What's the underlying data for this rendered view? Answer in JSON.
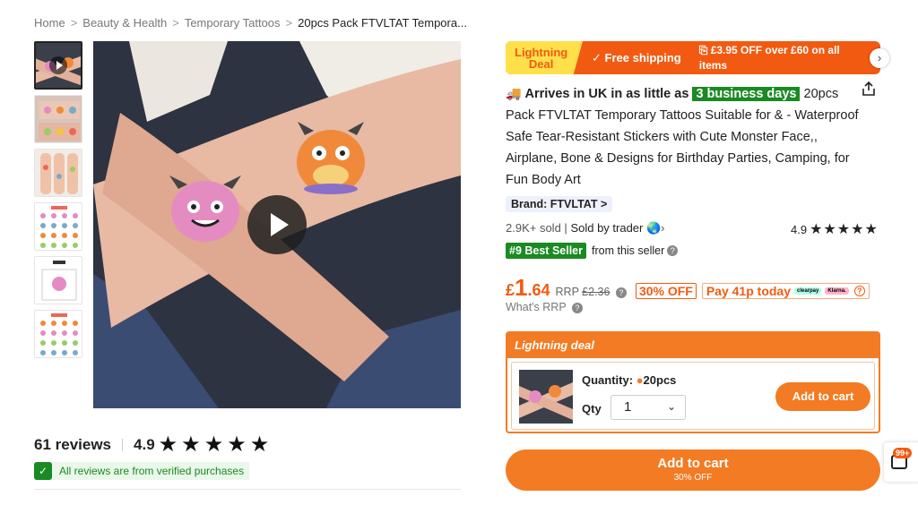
{
  "breadcrumb": {
    "items": [
      "Home",
      "Beauty & Health",
      "Temporary Tattoos",
      "20pcs Pack FTVLTAT Tempora..."
    ],
    "separator": ">"
  },
  "reviews": {
    "count_label": "61 reviews",
    "rating": "4.9",
    "stars": "★★★★★",
    "verified_text": "All reviews are from verified purchases"
  },
  "deal_banner": {
    "lightning_line1": "Lightning",
    "lightning_line2": "Deal",
    "free_shipping": "Free shipping",
    "coupon": "£3.95 OFF over £60 on all items",
    "next_icon": "chevron-right-icon"
  },
  "product": {
    "arrives_prefix": "Arrives in UK in as little as",
    "arrives_days": "3 business days",
    "title": "20pcs Pack FTVLTAT Temporary Tattoos Suitable for & - Waterproof Safe Tear-Resistant Stickers with Cute Monster Face,, Airplane, Bone & Designs for Birthday Parties, Camping, for Fun Body Art",
    "brand": "Brand: FTVLTAT",
    "brand_chevron": ">",
    "sold": "2.9K+ sold",
    "sold_divider": "|",
    "sold_by": "Sold by trader",
    "store_rating": "4.9",
    "store_stars": "★★★★★",
    "best_seller_badge": "#9 Best Seller",
    "best_seller_text": "from this seller"
  },
  "price": {
    "currency": "£",
    "integer": "1",
    "decimal": ".64",
    "rrp_label": "RRP",
    "rrp_value": "£2.36",
    "discount": "30% OFF",
    "pay_today": "Pay 41p today",
    "clearpay": "clearpay",
    "klarna": "Klarna.",
    "whats_rrp": "What's RRP"
  },
  "deal_box": {
    "header": "Lightning deal",
    "quantity_label": "Quantity:",
    "quantity_value": "20pcs",
    "qty_label": "Qty",
    "qty_value": "1",
    "add_to_cart": "Add to cart"
  },
  "main_cart": {
    "label": "Add to cart",
    "sub": "30% OFF"
  },
  "chat": {
    "badge": "99+"
  },
  "colors": {
    "accent_orange": "#f27b23",
    "deal_red": "#f25a11",
    "success_green": "#1a8a22",
    "lightning_yellow": "#ffe04a"
  }
}
